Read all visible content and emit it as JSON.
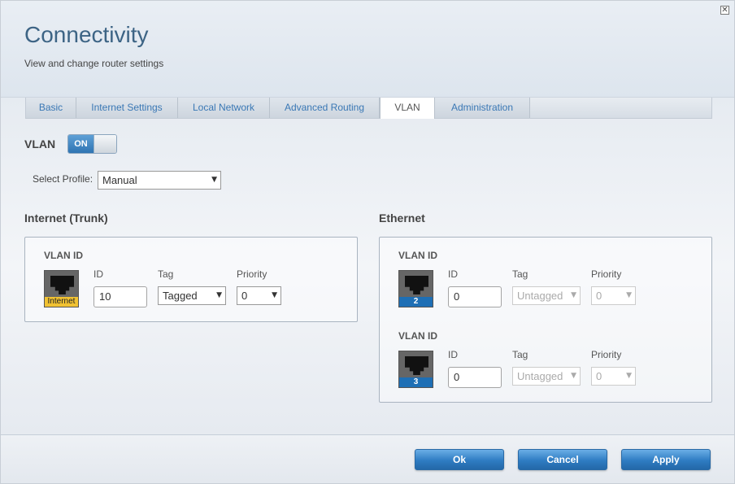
{
  "header": {
    "title": "Connectivity",
    "subtitle": "View and change router settings",
    "close_symbol": "✕"
  },
  "tabs": [
    {
      "label": "Basic",
      "active": false
    },
    {
      "label": "Internet Settings",
      "active": false
    },
    {
      "label": "Local Network",
      "active": false
    },
    {
      "label": "Advanced Routing",
      "active": false
    },
    {
      "label": "VLAN",
      "active": true
    },
    {
      "label": "Administration",
      "active": false
    }
  ],
  "vlan": {
    "label": "VLAN",
    "toggle_label": "ON",
    "toggle_state": true
  },
  "profile": {
    "label": "Select Profile:",
    "value": "Manual"
  },
  "internet": {
    "section_title": "Internet (Trunk)",
    "group_title": "VLAN ID",
    "port_label": "Internet",
    "id_label": "ID",
    "id_value": "10",
    "tag_label": "Tag",
    "tag_value": "Tagged",
    "priority_label": "Priority",
    "priority_value": "0"
  },
  "ethernet": {
    "section_title": "Ethernet",
    "ports": [
      {
        "group_title": "VLAN ID",
        "port_label": "2",
        "id_label": "ID",
        "id_value": "0",
        "tag_label": "Tag",
        "tag_value": "Untagged",
        "priority_label": "Priority",
        "priority_value": "0"
      },
      {
        "group_title": "VLAN ID",
        "port_label": "3",
        "id_label": "ID",
        "id_value": "0",
        "tag_label": "Tag",
        "tag_value": "Untagged",
        "priority_label": "Priority",
        "priority_value": "0"
      }
    ]
  },
  "footer": {
    "ok_label": "Ok",
    "cancel_label": "Cancel",
    "apply_label": "Apply"
  },
  "icons": {
    "dropdown": "▼"
  },
  "colors": {
    "title": "#3d6485",
    "tab_link": "#3a78b5",
    "toggle_on": "#2f74b3",
    "button": "#2f7cc2",
    "internet_port_label": "#f1c232",
    "ethernet_port_label": "#1e6fb5"
  }
}
